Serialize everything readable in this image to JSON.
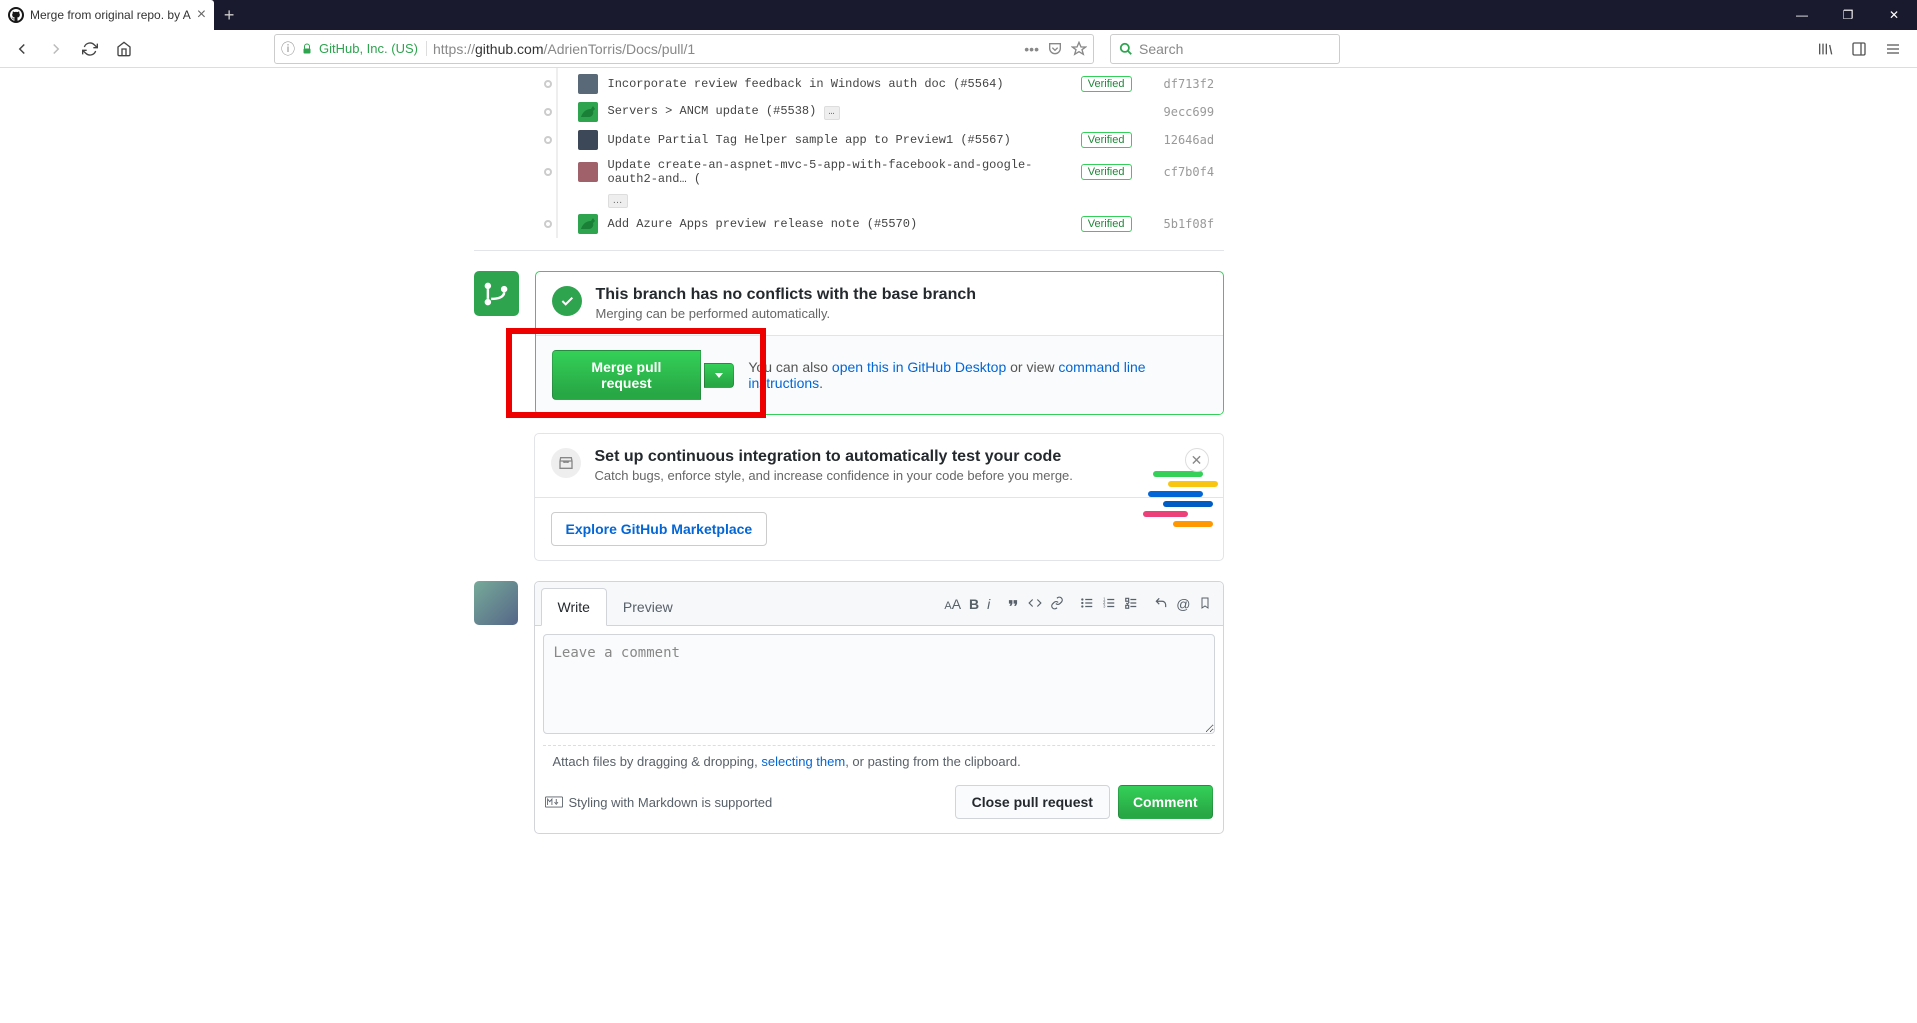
{
  "window": {
    "tab_title": "Merge from original repo. by A",
    "new_tab": "+",
    "minimize": "—",
    "maximize": "❐",
    "close": "✕"
  },
  "navbar": {
    "site_identity": "GitHub, Inc. (US)",
    "url_prefix": "https://",
    "url_domain": "github.com",
    "url_path": "/AdrienTorris/Docs/pull/1",
    "search_placeholder": "Search"
  },
  "commits": [
    {
      "msg": "Incorporate review feedback in Windows auth doc (#5564)",
      "verified": true,
      "sha": "df713f2",
      "avatar": "user1",
      "ellipsis": false
    },
    {
      "msg": "Servers > ANCM update (#5538)",
      "verified": false,
      "sha": "9ecc699",
      "avatar": "dino",
      "ellipsis": true
    },
    {
      "msg": "Update Partial Tag Helper sample app to Preview1 (#5567)",
      "verified": true,
      "sha": "12646ad",
      "avatar": "user2",
      "ellipsis": false
    },
    {
      "msg": "Update create-an-aspnet-mvc-5-app-with-facebook-and-google-oauth2-and… (",
      "verified": true,
      "sha": "cf7b0f4",
      "avatar": "user3",
      "ellipsis": true,
      "ellipsis_below": true
    },
    {
      "msg": "Add Azure Apps preview release note (#5570)",
      "verified": true,
      "sha": "5b1f08f",
      "avatar": "dino",
      "ellipsis": false
    }
  ],
  "merge": {
    "title": "This branch has no conflicts with the base branch",
    "subtitle": "Merging can be performed automatically.",
    "button": "Merge pull request",
    "hint_prefix": "You can also ",
    "hint_link1": "open this in GitHub Desktop",
    "hint_mid": " or view ",
    "hint_link2": "command line instructions",
    "hint_suffix": "."
  },
  "ci": {
    "title": "Set up continuous integration to automatically test your code",
    "subtitle": "Catch bugs, enforce style, and increase confidence in your code before you merge.",
    "button": "Explore GitHub Marketplace"
  },
  "comment": {
    "tab_write": "Write",
    "tab_preview": "Preview",
    "placeholder": "Leave a comment",
    "attach_prefix": "Attach files by dragging & dropping, ",
    "attach_link": "selecting them",
    "attach_suffix": ", or pasting from the clipboard.",
    "md_support": "Styling with Markdown is supported",
    "close_btn": "Close pull request",
    "comment_btn": "Comment"
  },
  "verified_label": "Verified"
}
